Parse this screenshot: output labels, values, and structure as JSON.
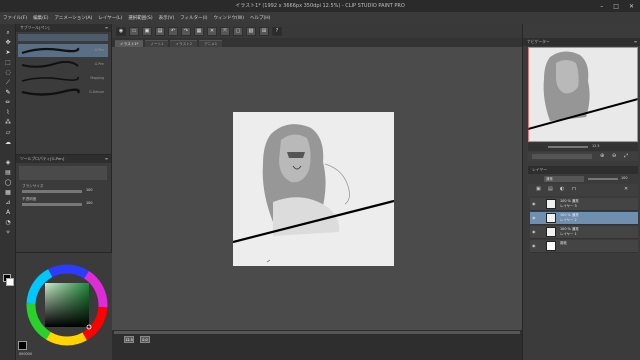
{
  "window": {
    "title": "イラスト1* (1992 x 3666px 350dpi 12.5%) - CLIP STUDIO PAINT PRO",
    "controls": [
      "–",
      "□",
      "✕"
    ]
  },
  "menu": [
    "ファイル(F)",
    "編集(E)",
    "アニメーション(A)",
    "レイヤー(L)",
    "選択範囲(S)",
    "表示(V)",
    "フィルター(I)",
    "ウィンドウ(W)",
    "ヘルプ(H)"
  ],
  "command_bar": {
    "icons": [
      "new-icon",
      "open-icon",
      "save-icon",
      "undo-icon",
      "redo-icon",
      "clear-icon",
      "transform-icon",
      "select-icon",
      "snap-icon",
      "help-icon"
    ],
    "glyphs": [
      "◉",
      "▭",
      "▣",
      "▤",
      "↶",
      "↷",
      "▦",
      "✕",
      "⤧",
      "▢",
      "▧",
      "⊞",
      "?"
    ]
  },
  "canvas_tabs": [
    "イラスト1*",
    "ノート1",
    "イラスト2",
    "アニメ1"
  ],
  "subtool_panel": {
    "title": "サブツール[ペン]",
    "brushes": [
      {
        "name": "G-Pen"
      },
      {
        "name": "G-Pen"
      },
      {
        "name": "Mapping"
      },
      {
        "name": "G-Deluxe"
      }
    ]
  },
  "tool_property": {
    "title": "ツールプロパティ[G-Pen]",
    "brush_size_label": "ブラシサイズ",
    "brush_size_value": "100",
    "opacity_label": "不透明度",
    "opacity_value": "100"
  },
  "color_panel": {
    "label": "カラーサークル",
    "value_readout": "000000"
  },
  "canvas_status": {
    "zoom": "12.5",
    "angle": "0.0"
  },
  "right_panel": {
    "navigator_title": "ナビゲーター",
    "zoom_value": "12.5",
    "layer_panel_title": "レイヤー",
    "blend_mode": "通常",
    "opacity_value": "100",
    "layers": [
      {
        "name": "レイヤー 3",
        "mode": "100 % 通常",
        "selected": false
      },
      {
        "name": "レイヤー 2",
        "mode": "100 % 通常",
        "selected": true
      },
      {
        "name": "レイヤー 1",
        "mode": "100 % 通常",
        "selected": false
      },
      {
        "name": "用紙",
        "mode": "",
        "selected": false
      }
    ]
  },
  "colors": {
    "bg": "#4a4a4a",
    "panel": "#3b3b3b",
    "title_bar": "#2a2a2a",
    "selected_layer": "#6f8fb0",
    "paper": "#ededed"
  }
}
